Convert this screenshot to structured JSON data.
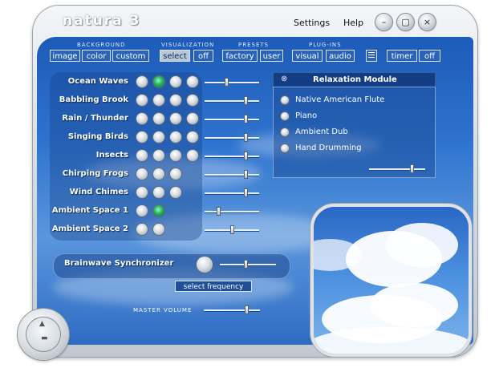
{
  "app": {
    "title": "natura 3"
  },
  "menu": {
    "settings": "Settings",
    "help": "Help"
  },
  "window_buttons": {
    "minimize": "–",
    "maximize": "▢",
    "close": "×"
  },
  "toolbar": {
    "background": {
      "label": "BACKGROUND",
      "buttons": [
        "image",
        "color",
        "custom"
      ]
    },
    "visualization": {
      "label": "VISUALIZATION",
      "buttons": [
        "select",
        "off"
      ],
      "active": "select"
    },
    "presets": {
      "label": "PRESETS",
      "buttons": [
        "factory",
        "user"
      ]
    },
    "plugins": {
      "label": "PLUG-INS",
      "buttons": [
        "visual",
        "audio"
      ]
    },
    "timer": {
      "buttons": [
        "timer",
        "off"
      ]
    }
  },
  "sounds": [
    {
      "label": "Ocean Waves",
      "balls": [
        false,
        true,
        false,
        false
      ],
      "level": 0.4
    },
    {
      "label": "Babbling Brook",
      "balls": [
        false,
        false,
        false,
        false
      ],
      "level": 0.75
    },
    {
      "label": "Rain / Thunder",
      "balls": [
        false,
        false,
        false,
        false
      ],
      "level": 0.75
    },
    {
      "label": "Singing Birds",
      "balls": [
        false,
        false,
        false,
        false
      ],
      "level": 0.75
    },
    {
      "label": "Insects",
      "balls": [
        false,
        false,
        false,
        false
      ],
      "level": 0.75
    },
    {
      "label": "Chirping Frogs",
      "balls": [
        false,
        false,
        false
      ],
      "level": 0.75
    },
    {
      "label": "Wind Chimes",
      "balls": [
        false,
        false,
        false
      ],
      "level": 0.75
    },
    {
      "label": "Ambient Space 1",
      "balls": [
        false,
        true
      ],
      "level": 0.25
    },
    {
      "label": "Ambient Space 2",
      "balls": [
        false,
        false
      ],
      "level": 0.5
    }
  ],
  "relaxation": {
    "title": "Relaxation Module",
    "items": [
      "Native American Flute",
      "Piano",
      "Ambient Dub",
      "Hand Drumming"
    ],
    "level": 0.75
  },
  "brainwave": {
    "label": "Brainwave Synchronizer",
    "select_label": "select frequency",
    "level": 0.45
  },
  "master": {
    "label": "MASTER VOLUME",
    "level": 0.75
  },
  "colors": {
    "panel": "#2f74cf",
    "accent": "#23b45a",
    "frame": "#d9dee4"
  }
}
